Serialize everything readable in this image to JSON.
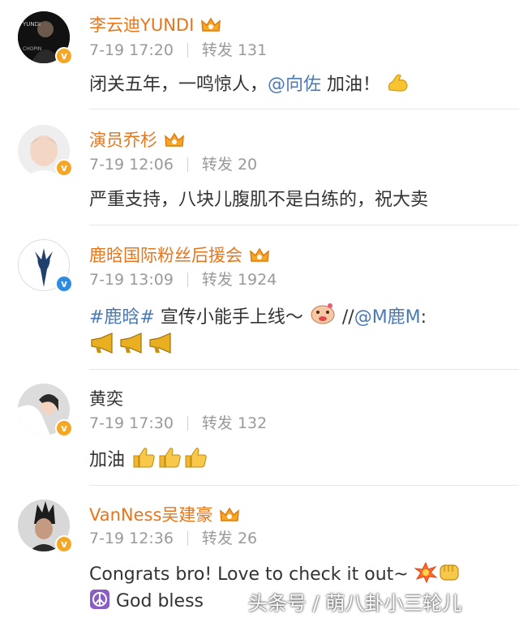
{
  "comments": [
    {
      "name": "李云迪YUNDI",
      "time": "7-19 17:20",
      "repost": "转发 131",
      "text": "闭关五年，一鸣惊人，",
      "mention": "@向佐",
      "text2": " 加油！",
      "badge": "v-gold"
    },
    {
      "name": "演员乔杉",
      "time": "7-19 12:06",
      "repost": "转发 20",
      "text": "严重支持，八块儿腹肌不是白练的，祝大卖",
      "badge": "v-gold"
    },
    {
      "name": "鹿晗国际粉丝后援会",
      "time": "7-19 13:09",
      "repost": "转发 1924",
      "topic": "#鹿晗#",
      "text": " 宣传小能手上线～",
      "text2": " //",
      "mention": "@M鹿M",
      "text3": ":",
      "badge": "v-blue"
    },
    {
      "name": "黄奕",
      "time": "7-19 17:30",
      "repost": "转发 132",
      "text": "加油",
      "badge": "v-gold"
    },
    {
      "name": "VanNess吴建豪",
      "time": "7-19 12:36",
      "repost": "转发 26",
      "text": "Congrats bro! Love to check it out~",
      "text2": " God bless",
      "badge": "v-gold"
    }
  ],
  "watermark": "头条号 / 萌八卦小三轮儿",
  "colors": {
    "name": "#e8751a",
    "link": "#4a7ab5",
    "meta": "#9a9a9a",
    "gold_badge": "#f5a623",
    "blue_badge": "#2d8ce0"
  }
}
